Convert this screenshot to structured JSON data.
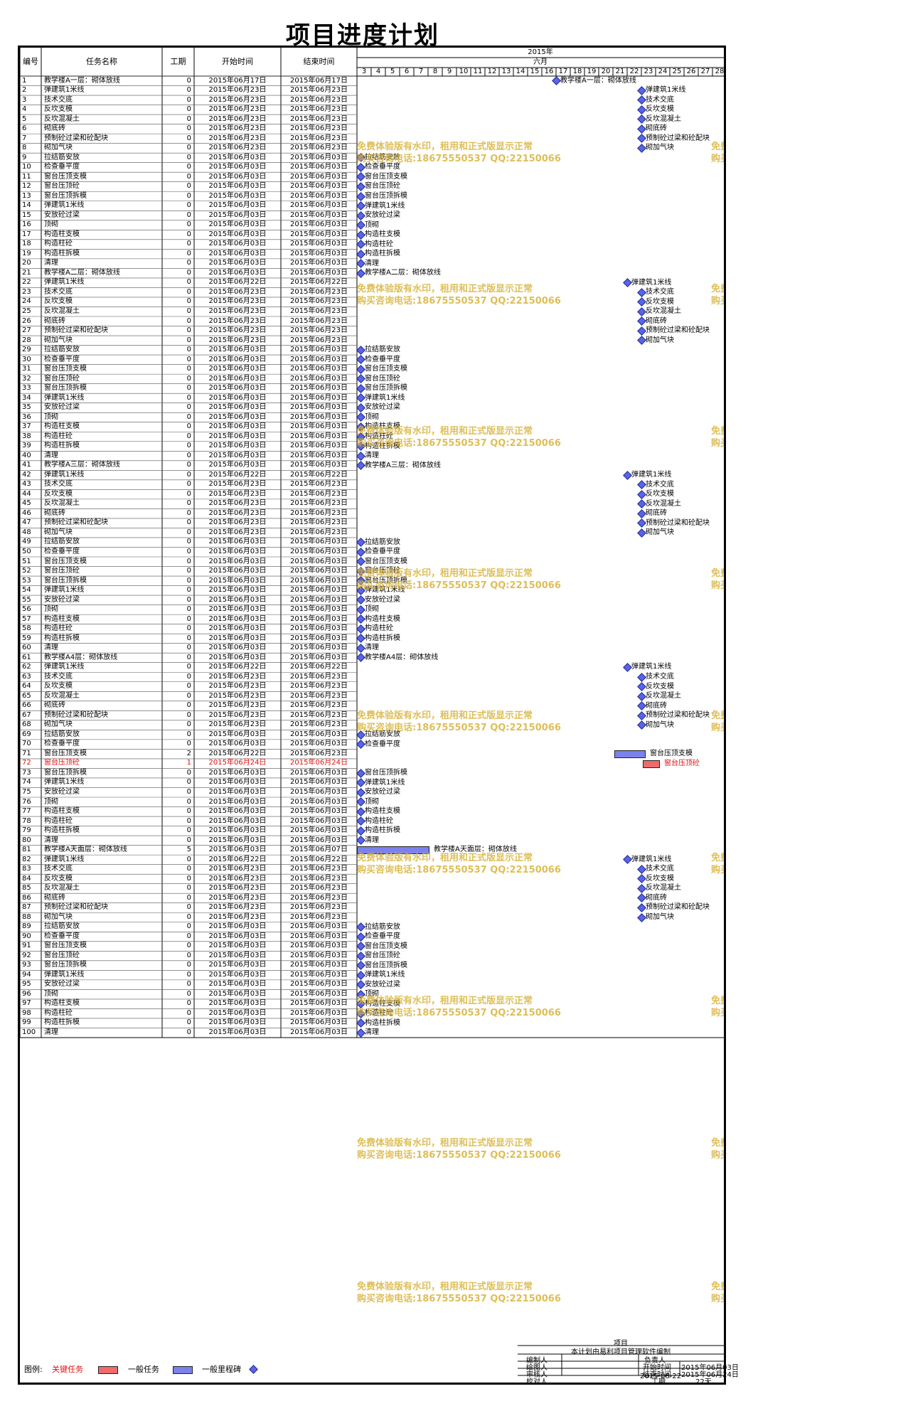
{
  "title": "项目进度计划",
  "headers": {
    "no": "编号",
    "name": "任务名称",
    "dur": "工期",
    "start": "开始时间",
    "end": "结束时间"
  },
  "timeline": {
    "year": "2015年",
    "month": "六月",
    "days": [
      "3",
      "4",
      "5",
      "6",
      "7",
      "8",
      "9",
      "10",
      "11",
      "12",
      "13",
      "14",
      "15",
      "16",
      "17",
      "18",
      "19",
      "20",
      "21",
      "22",
      "23",
      "24",
      "25",
      "26",
      "27",
      "28"
    ]
  },
  "tasks": [
    [
      "1",
      "教学楼A一层：砌体放线",
      "0",
      "2015年06月17日",
      "2015年06月17日"
    ],
    [
      "2",
      "弹建筑1米线",
      "0",
      "2015年06月23日",
      "2015年06月23日"
    ],
    [
      "3",
      "技术交底",
      "0",
      "2015年06月23日",
      "2015年06月23日"
    ],
    [
      "4",
      "反坎支模",
      "0",
      "2015年06月23日",
      "2015年06月23日"
    ],
    [
      "5",
      "反坎混凝土",
      "0",
      "2015年06月23日",
      "2015年06月23日"
    ],
    [
      "6",
      "砌底砖",
      "0",
      "2015年06月23日",
      "2015年06月23日"
    ],
    [
      "7",
      "预制砼过梁和砼配块",
      "0",
      "2015年06月23日",
      "2015年06月23日"
    ],
    [
      "8",
      "砌加气块",
      "0",
      "2015年06月23日",
      "2015年06月23日"
    ],
    [
      "9",
      "拉结筋安放",
      "0",
      "2015年06月03日",
      "2015年06月03日"
    ],
    [
      "10",
      "检查垂平度",
      "0",
      "2015年06月03日",
      "2015年06月03日"
    ],
    [
      "11",
      "窗台压顶支模",
      "0",
      "2015年06月03日",
      "2015年06月03日"
    ],
    [
      "12",
      "窗台压顶砼",
      "0",
      "2015年06月03日",
      "2015年06月03日"
    ],
    [
      "13",
      "窗台压顶拆模",
      "0",
      "2015年06月03日",
      "2015年06月03日"
    ],
    [
      "14",
      "弹建筑1米线",
      "0",
      "2015年06月03日",
      "2015年06月03日"
    ],
    [
      "15",
      "安放砼过梁",
      "0",
      "2015年06月03日",
      "2015年06月03日"
    ],
    [
      "16",
      "顶砌",
      "0",
      "2015年06月03日",
      "2015年06月03日"
    ],
    [
      "17",
      "构造柱支模",
      "0",
      "2015年06月03日",
      "2015年06月03日"
    ],
    [
      "18",
      "构造柱砼",
      "0",
      "2015年06月03日",
      "2015年06月03日"
    ],
    [
      "19",
      "构造柱拆模",
      "0",
      "2015年06月03日",
      "2015年06月03日"
    ],
    [
      "20",
      "清理",
      "0",
      "2015年06月03日",
      "2015年06月03日"
    ],
    [
      "21",
      "教学楼A二层：砌体放线",
      "0",
      "2015年06月03日",
      "2015年06月03日"
    ],
    [
      "22",
      "弹建筑1米线",
      "0",
      "2015年06月22日",
      "2015年06月22日"
    ],
    [
      "23",
      "技术交底",
      "0",
      "2015年06月23日",
      "2015年06月23日"
    ],
    [
      "24",
      "反坎支模",
      "0",
      "2015年06月23日",
      "2015年06月23日"
    ],
    [
      "25",
      "反坎混凝土",
      "0",
      "2015年06月23日",
      "2015年06月23日"
    ],
    [
      "26",
      "砌底砖",
      "0",
      "2015年06月23日",
      "2015年06月23日"
    ],
    [
      "27",
      "预制砼过梁和砼配块",
      "0",
      "2015年06月23日",
      "2015年06月23日"
    ],
    [
      "28",
      "砌加气块",
      "0",
      "2015年06月23日",
      "2015年06月23日"
    ],
    [
      "29",
      "拉结筋安放",
      "0",
      "2015年06月03日",
      "2015年06月03日"
    ],
    [
      "30",
      "检查垂平度",
      "0",
      "2015年06月03日",
      "2015年06月03日"
    ],
    [
      "31",
      "窗台压顶支模",
      "0",
      "2015年06月03日",
      "2015年06月03日"
    ],
    [
      "32",
      "窗台压顶砼",
      "0",
      "2015年06月03日",
      "2015年06月03日"
    ],
    [
      "33",
      "窗台压顶拆模",
      "0",
      "2015年06月03日",
      "2015年06月03日"
    ],
    [
      "34",
      "弹建筑1米线",
      "0",
      "2015年06月03日",
      "2015年06月03日"
    ],
    [
      "35",
      "安放砼过梁",
      "0",
      "2015年06月03日",
      "2015年06月03日"
    ],
    [
      "36",
      "顶砌",
      "0",
      "2015年06月03日",
      "2015年06月03日"
    ],
    [
      "37",
      "构造柱支模",
      "0",
      "2015年06月03日",
      "2015年06月03日"
    ],
    [
      "38",
      "构造柱砼",
      "0",
      "2015年06月03日",
      "2015年06月03日"
    ],
    [
      "39",
      "构造柱拆模",
      "0",
      "2015年06月03日",
      "2015年06月03日"
    ],
    [
      "40",
      "清理",
      "0",
      "2015年06月03日",
      "2015年06月03日"
    ],
    [
      "41",
      "教学楼A三层：砌体放线",
      "0",
      "2015年06月03日",
      "2015年06月03日"
    ],
    [
      "42",
      "弹建筑1米线",
      "0",
      "2015年06月22日",
      "2015年06月22日"
    ],
    [
      "43",
      "技术交底",
      "0",
      "2015年06月23日",
      "2015年06月23日"
    ],
    [
      "44",
      "反坎支模",
      "0",
      "2015年06月23日",
      "2015年06月23日"
    ],
    [
      "45",
      "反坎混凝土",
      "0",
      "2015年06月23日",
      "2015年06月23日"
    ],
    [
      "46",
      "砌底砖",
      "0",
      "2015年06月23日",
      "2015年06月23日"
    ],
    [
      "47",
      "预制砼过梁和砼配块",
      "0",
      "2015年06月23日",
      "2015年06月23日"
    ],
    [
      "48",
      "砌加气块",
      "0",
      "2015年06月23日",
      "2015年06月23日"
    ],
    [
      "49",
      "拉结筋安放",
      "0",
      "2015年06月03日",
      "2015年06月03日"
    ],
    [
      "50",
      "检查垂平度",
      "0",
      "2015年06月03日",
      "2015年06月03日"
    ],
    [
      "51",
      "窗台压顶支模",
      "0",
      "2015年06月03日",
      "2015年06月03日"
    ],
    [
      "52",
      "窗台压顶砼",
      "0",
      "2015年06月03日",
      "2015年06月03日"
    ],
    [
      "53",
      "窗台压顶拆模",
      "0",
      "2015年06月03日",
      "2015年06月03日"
    ],
    [
      "54",
      "弹建筑1米线",
      "0",
      "2015年06月03日",
      "2015年06月03日"
    ],
    [
      "55",
      "安放砼过梁",
      "0",
      "2015年06月03日",
      "2015年06月03日"
    ],
    [
      "56",
      "顶砌",
      "0",
      "2015年06月03日",
      "2015年06月03日"
    ],
    [
      "57",
      "构造柱支模",
      "0",
      "2015年06月03日",
      "2015年06月03日"
    ],
    [
      "58",
      "构造柱砼",
      "0",
      "2015年06月03日",
      "2015年06月03日"
    ],
    [
      "59",
      "构造柱拆模",
      "0",
      "2015年06月03日",
      "2015年06月03日"
    ],
    [
      "60",
      "清理",
      "0",
      "2015年06月03日",
      "2015年06月03日"
    ],
    [
      "61",
      "教学楼A4层：砌体放线",
      "0",
      "2015年06月03日",
      "2015年06月03日"
    ],
    [
      "62",
      "弹建筑1米线",
      "0",
      "2015年06月22日",
      "2015年06月22日"
    ],
    [
      "63",
      "技术交底",
      "0",
      "2015年06月23日",
      "2015年06月23日"
    ],
    [
      "64",
      "反坎支模",
      "0",
      "2015年06月23日",
      "2015年06月23日"
    ],
    [
      "65",
      "反坎混凝土",
      "0",
      "2015年06月23日",
      "2015年06月23日"
    ],
    [
      "66",
      "砌底砖",
      "0",
      "2015年06月23日",
      "2015年06月23日"
    ],
    [
      "67",
      "预制砼过梁和砼配块",
      "0",
      "2015年06月23日",
      "2015年06月23日"
    ],
    [
      "68",
      "砌加气块",
      "0",
      "2015年06月23日",
      "2015年06月23日"
    ],
    [
      "69",
      "拉结筋安放",
      "0",
      "2015年06月03日",
      "2015年06月03日"
    ],
    [
      "70",
      "检查垂平度",
      "0",
      "2015年06月03日",
      "2015年06月03日"
    ],
    [
      "71",
      "窗台压顶支模",
      "2",
      "2015年06月22日",
      "2015年06月23日"
    ],
    [
      "72",
      "窗台压顶砼",
      "1",
      "2015年06月24日",
      "2015年06月24日"
    ],
    [
      "73",
      "窗台压顶拆模",
      "0",
      "2015年06月03日",
      "2015年06月03日"
    ],
    [
      "74",
      "弹建筑1米线",
      "0",
      "2015年06月03日",
      "2015年06月03日"
    ],
    [
      "75",
      "安放砼过梁",
      "0",
      "2015年06月03日",
      "2015年06月03日"
    ],
    [
      "76",
      "顶砌",
      "0",
      "2015年06月03日",
      "2015年06月03日"
    ],
    [
      "77",
      "构造柱支模",
      "0",
      "2015年06月03日",
      "2015年06月03日"
    ],
    [
      "78",
      "构造柱砼",
      "0",
      "2015年06月03日",
      "2015年06月03日"
    ],
    [
      "79",
      "构造柱拆模",
      "0",
      "2015年06月03日",
      "2015年06月03日"
    ],
    [
      "80",
      "清理",
      "0",
      "2015年06月03日",
      "2015年06月03日"
    ],
    [
      "81",
      "教学楼A天面层：砌体放线",
      "5",
      "2015年06月03日",
      "2015年06月07日"
    ],
    [
      "82",
      "弹建筑1米线",
      "0",
      "2015年06月22日",
      "2015年06月22日"
    ],
    [
      "83",
      "技术交底",
      "0",
      "2015年06月23日",
      "2015年06月23日"
    ],
    [
      "84",
      "反坎支模",
      "0",
      "2015年06月23日",
      "2015年06月23日"
    ],
    [
      "85",
      "反坎混凝土",
      "0",
      "2015年06月23日",
      "2015年06月23日"
    ],
    [
      "86",
      "砌底砖",
      "0",
      "2015年06月23日",
      "2015年06月23日"
    ],
    [
      "87",
      "预制砼过梁和砼配块",
      "0",
      "2015年06月23日",
      "2015年06月23日"
    ],
    [
      "88",
      "砌加气块",
      "0",
      "2015年06月23日",
      "2015年06月23日"
    ],
    [
      "89",
      "拉结筋安放",
      "0",
      "2015年06月03日",
      "2015年06月03日"
    ],
    [
      "90",
      "检查垂平度",
      "0",
      "2015年06月03日",
      "2015年06月03日"
    ],
    [
      "91",
      "窗台压顶支模",
      "0",
      "2015年06月03日",
      "2015年06月03日"
    ],
    [
      "92",
      "窗台压顶砼",
      "0",
      "2015年06月03日",
      "2015年06月03日"
    ],
    [
      "93",
      "窗台压顶拆模",
      "0",
      "2015年06月03日",
      "2015年06月03日"
    ],
    [
      "94",
      "弹建筑1米线",
      "0",
      "2015年06月03日",
      "2015年06月03日"
    ],
    [
      "95",
      "安放砼过梁",
      "0",
      "2015年06月03日",
      "2015年06月03日"
    ],
    [
      "96",
      "顶砌",
      "0",
      "2015年06月03日",
      "2015年06月03日"
    ],
    [
      "97",
      "构造柱支模",
      "0",
      "2015年06月03日",
      "2015年06月03日"
    ],
    [
      "98",
      "构造柱砼",
      "0",
      "2015年06月03日",
      "2015年06月03日"
    ],
    [
      "99",
      "构造柱拆模",
      "0",
      "2015年06月03日",
      "2015年06月03日"
    ],
    [
      "100",
      "清理",
      "0",
      "2015年06月03日",
      "2015年06月03日"
    ]
  ],
  "critical_rows": [
    "72"
  ],
  "watermark": {
    "line1": "免费体验版有水印，租用和正式版显示正常",
    "line2": "购买咨询电话:18675550537 QQ:22150066"
  },
  "legend": {
    "label": "图例:",
    "critical": "关键任务",
    "normal": "一般任务",
    "milestone": "一般里程碑"
  },
  "colors": {
    "milestone": "#5a64e6",
    "normal_bar": "#7b82ee",
    "critical_bar": "#f06b6b",
    "critical_text": "#e01010",
    "watermark": "#d9b33a"
  },
  "footer": {
    "project_label": "项目",
    "note": "本计划由易利项目管理软件编制",
    "compiler": "编制人",
    "responsible": "负责人",
    "drawer": "绘图人",
    "start_label": "开始时间",
    "start_value": "2015年06月03日",
    "reviewer": "审核人",
    "end_label": "结束时间",
    "end_value": "2015年06月24日",
    "checker": "校对人",
    "duration_label": "工期",
    "duration_value": "22天",
    "date": "2015-06-22"
  }
}
